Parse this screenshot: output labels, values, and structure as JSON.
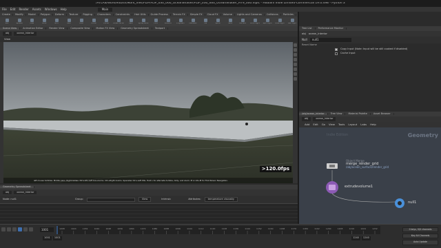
{
  "window": {
    "title": "/ATLAS/Work/edu/sh/work_files/FLIP/FLIP_030_060_OceanShader/FLIP_030_060_OceanShader_HY9_000.hiplc - Houdini Indie Limited-Commercial 19.0.498 - Python 3"
  },
  "menubar": [
    "File",
    "Edit",
    "Render",
    "Assets",
    "Windows",
    "Help"
  ],
  "desktop": "Main",
  "shelf_tabs": [
    "Create",
    "Modify",
    "Model",
    "Polygon",
    "Deform",
    "Texture",
    "Rigging",
    "Characters",
    "Constraints",
    "Hair Utils",
    "Guide Process",
    "Terrain FX",
    "Simple FX",
    "Cloud FX",
    "Volume",
    "Lights and Cameras",
    "Collisions",
    "Particles",
    "Grains",
    "Rigid Bodies",
    "Particle Fluids",
    "Viscous Fluids",
    "Oceans",
    "Pyro FX",
    "FEM",
    "Wires",
    "Crowds",
    "Drive Simulation"
  ],
  "shelf_tools": [
    "Box",
    "Sphere",
    "Tube",
    "Torus",
    "Grid",
    "Null",
    "Line",
    "Circle",
    "Curve",
    "Draw Curve",
    "Path",
    "Spray Paint",
    "Font",
    "Platonic",
    "L-System",
    "Metaball",
    "File",
    "Spiral",
    "Helix",
    "Camera",
    "Point Light",
    "Spot Light",
    "Area Light",
    "Geo Light",
    "Volume Light",
    "Distant Light",
    "Env Light",
    "Sky Light",
    "GI Light",
    "Caustic",
    "Portal",
    "Ambient",
    "Stereo Cam",
    "VR Camera",
    "Switcher",
    "Gamepad"
  ],
  "viewport": {
    "tabs": [
      "Scene View",
      "Animation Editor",
      "Render View",
      "Composite View",
      "Motion FX View",
      "Geometry Spreadsheet",
      "Textport"
    ],
    "path": [
      "obj",
      "ocean_interior"
    ],
    "label": "View",
    "fps": ">120.0fps",
    "status": "left mouse tumbles. Middle pans. Right dollies. Ctrl+Alt+Left box-zooms. Ctrl+Right zooms. Spacebar Ctrl+Left tilts. Hold L for alternate tumble, dolly, and zoom.    M or Alt+M for First Person Navigation."
  },
  "lower_pane": {
    "tabs": [
      "Geometry Spreadsheet"
    ],
    "path": [
      "obj",
      "ocean_interior"
    ],
    "node_label": "Node: null1",
    "group_label": "Group:",
    "view_label": "View",
    "intrinsic_label": "Intrinsic",
    "attributes_label": "Attributes:",
    "attributes_value": "temperature viscosity"
  },
  "timeline": {
    "frame": "1001",
    "start": "1001",
    "start2": "1001",
    "end": "1240",
    "end2": "1240",
    "ticks": [
      "1008",
      "1024",
      "1032",
      "1040",
      "1048",
      "1056",
      "1064",
      "1072",
      "1080",
      "1088",
      "1096",
      "1104",
      "1112",
      "1120",
      "1128",
      "1136",
      "1144",
      "1152",
      "1160",
      "1168",
      "1176",
      "1184",
      "1192",
      "1200",
      "1208",
      "1216",
      "1224",
      "1232"
    ],
    "keys_label": "0 keys, 0/0 channels",
    "key_all_label": "Key All Channels",
    "auto_update": "Auto Update"
  },
  "params": {
    "tabs": [
      "Tree List",
      "Performance Monitor"
    ],
    "path": [
      "obj",
      "ocean_interior"
    ],
    "node_type": "Null",
    "node_name": "null1",
    "reset_label": "Reset Name",
    "rows": [
      {
        "label": "Copy Input (Note: Input will be still cooked if disabled)",
        "checked": true
      },
      {
        "label": "Cache Input",
        "checked": false
      }
    ]
  },
  "network": {
    "tabs": [
      "/obj/ocean_interior",
      "Tree View",
      "Material Palette",
      "Asset Browser"
    ],
    "path": [
      "obj",
      "ocean_interior"
    ],
    "menu": [
      "Add",
      "Edit",
      "Go",
      "View",
      "Tools",
      "Layout",
      "Labs",
      "Help"
    ],
    "context": "Geometry",
    "ghost": "Indie Edition",
    "nodes": [
      {
        "type": "Object Merge",
        "name": "merge_render_grid",
        "sub": "/obj/ocean_surface/render_grid"
      },
      {
        "type": "",
        "name": "extrudevolume1",
        "sub": ""
      },
      {
        "type": "",
        "name": "null1",
        "sub": ""
      }
    ]
  },
  "colors": {
    "accent": "#3e6fb0",
    "net_bg": "#3a4049",
    "purple_node": "#8c5ab4"
  }
}
